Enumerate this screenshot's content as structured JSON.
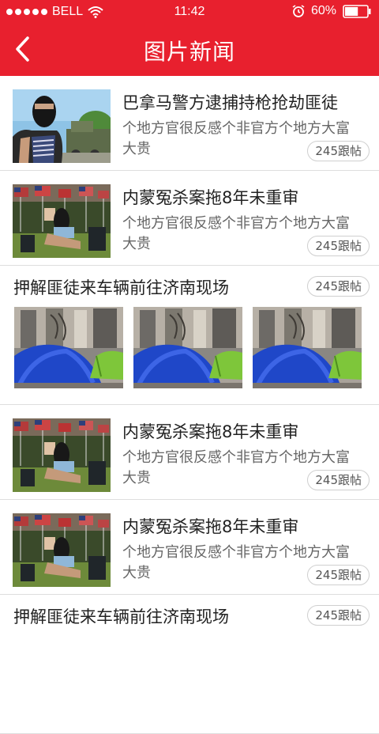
{
  "status_bar": {
    "carrier": "BELL",
    "time": "11:42",
    "battery": "60%",
    "battery_level": 0.6
  },
  "nav": {
    "title": "图片新闻",
    "back_icon": "chevron-left-icon"
  },
  "colors": {
    "header": "#e8202e",
    "divider": "#dedede"
  },
  "items": [
    {
      "type": "single",
      "title": "巴拿马警方逮捕持枪抢劫匪徒",
      "summary": "个地方官很反感个非官方个地方大富大贵",
      "comments": "245跟帖"
    },
    {
      "type": "single",
      "title": "内蒙冤杀案拖8年未重审",
      "summary": "个地方官很反感个非官方个地方大富大贵",
      "comments": "245跟帖"
    },
    {
      "type": "gallery",
      "title": "押解匪徒来车辆前往济南现场",
      "comments": "245跟帖"
    },
    {
      "type": "single",
      "title": "内蒙冤杀案拖8年未重审",
      "summary": "个地方官很反感个非官方个地方大富大贵",
      "comments": "245跟帖"
    },
    {
      "type": "single",
      "title": "内蒙冤杀案拖8年未重审",
      "summary": "个地方官很反感个非官方个地方大富大贵",
      "comments": "245跟帖"
    },
    {
      "type": "gallery",
      "title": "押解匪徒来车辆前往济南现场",
      "comments": "245跟帖"
    }
  ]
}
